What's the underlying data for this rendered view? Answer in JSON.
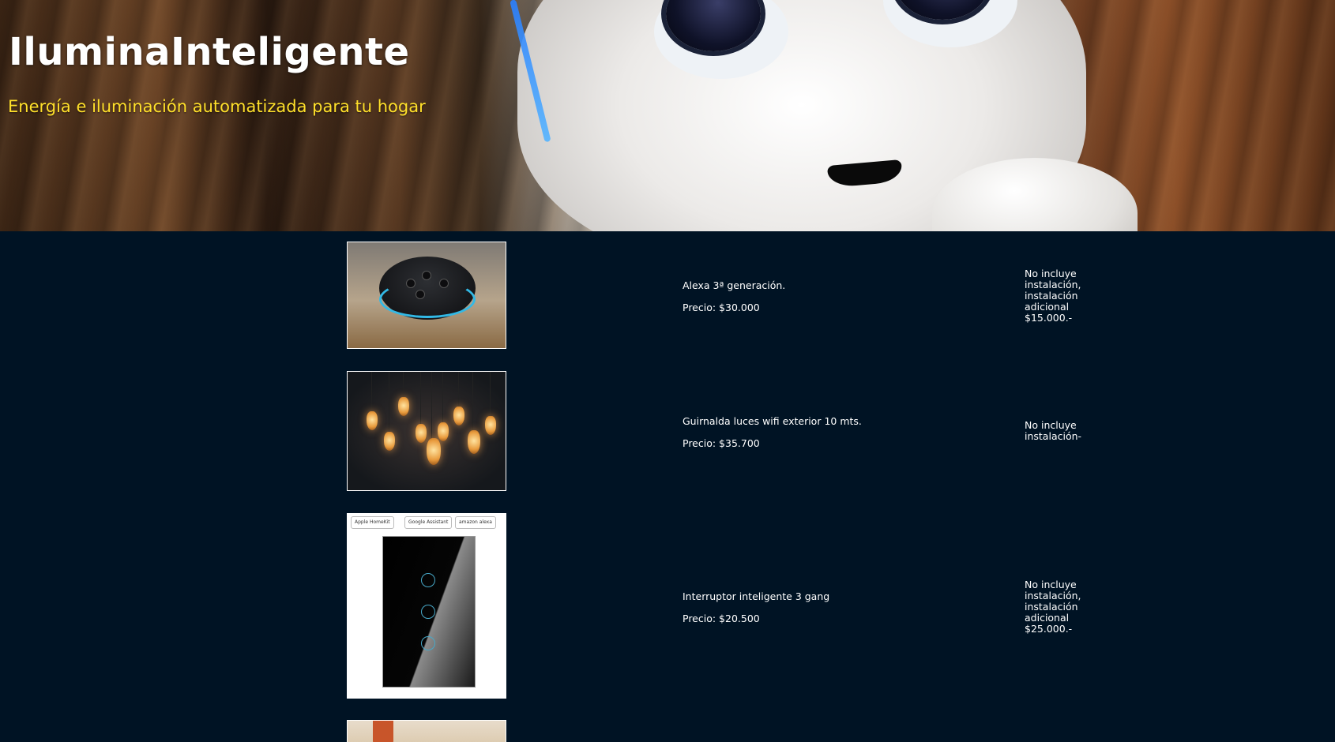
{
  "hero": {
    "title_light": "Ilumina",
    "title_bold": "Inteligente",
    "subtitle": "Energía e iluminación automatizada para tu hogar"
  },
  "products": [
    {
      "name": "Alexa 3ª generación.",
      "price": "Precio: $30.000",
      "note": "No incluye instalación, instalación adicional $15.000.-"
    },
    {
      "name": "Guirnalda luces wifi exterior 10 mts.",
      "price": "Precio: $35.700",
      "note": "No incluye instalación-"
    },
    {
      "name": "Interruptor inteligente 3 gang",
      "price": "Precio: $20.500",
      "note": "No incluye instalación, instalación adicional $25.000.-",
      "badges": [
        "Apple HomeKit",
        "Google Assistant",
        "amazon alexa"
      ]
    }
  ]
}
